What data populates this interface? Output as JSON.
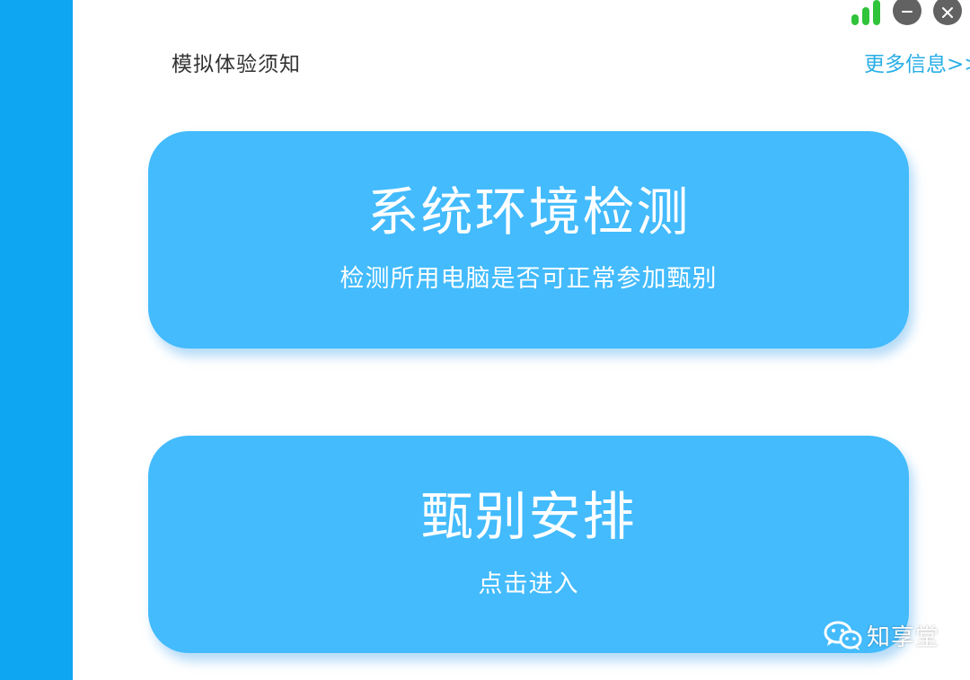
{
  "header": {
    "notice_label": "模拟体验须知",
    "more_link": "更多信息>>"
  },
  "window_controls": {
    "signal_icon": "signal-bars-icon",
    "minimize_icon": "minimize-icon",
    "close_icon": "close-icon"
  },
  "cards": [
    {
      "title": "系统环境检测",
      "subtitle": "检测所用电脑是否可正常参加甄别"
    },
    {
      "title": "甄别安排",
      "subtitle": "点击进入"
    }
  ],
  "watermark": {
    "icon": "wechat-icon",
    "text": "知享堂"
  },
  "colors": {
    "sidebar": "#0ea6f2",
    "card": "#43bbfd",
    "link": "#29aee6",
    "signal": "#2fc43a",
    "control_button": "#626262"
  }
}
